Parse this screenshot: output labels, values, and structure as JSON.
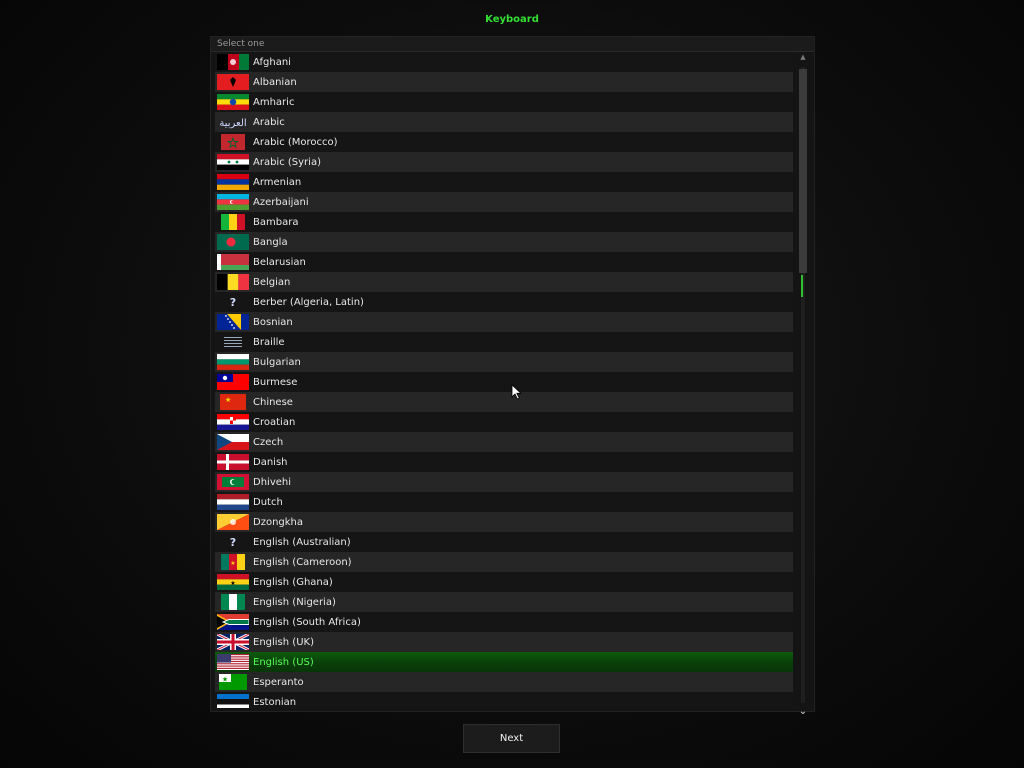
{
  "title": "Keyboard",
  "list_header": "Select one",
  "items": [
    {
      "label": "Afghani",
      "flag": "afghanistan"
    },
    {
      "label": "Albanian",
      "flag": "albania"
    },
    {
      "label": "Amharic",
      "flag": "ethiopia"
    },
    {
      "label": "Arabic",
      "flag": "arabic-script"
    },
    {
      "label": "Arabic (Morocco)",
      "flag": "morocco"
    },
    {
      "label": "Arabic (Syria)",
      "flag": "syria"
    },
    {
      "label": "Armenian",
      "flag": "armenia"
    },
    {
      "label": "Azerbaijani",
      "flag": "azerbaijan"
    },
    {
      "label": "Bambara",
      "flag": "mali"
    },
    {
      "label": "Bangla",
      "flag": "bangladesh"
    },
    {
      "label": "Belarusian",
      "flag": "belarus"
    },
    {
      "label": "Belgian",
      "flag": "belgium"
    },
    {
      "label": "Berber (Algeria, Latin)",
      "flag": "unknown"
    },
    {
      "label": "Bosnian",
      "flag": "bosnia"
    },
    {
      "label": "Braille",
      "flag": "braille"
    },
    {
      "label": "Bulgarian",
      "flag": "bulgaria"
    },
    {
      "label": "Burmese",
      "flag": "taiwan"
    },
    {
      "label": "Chinese",
      "flag": "china"
    },
    {
      "label": "Croatian",
      "flag": "croatia"
    },
    {
      "label": "Czech",
      "flag": "czech"
    },
    {
      "label": "Danish",
      "flag": "denmark"
    },
    {
      "label": "Dhivehi",
      "flag": "maldives"
    },
    {
      "label": "Dutch",
      "flag": "netherlands"
    },
    {
      "label": "Dzongkha",
      "flag": "bhutan"
    },
    {
      "label": "English (Australian)",
      "flag": "unknown"
    },
    {
      "label": "English (Cameroon)",
      "flag": "cameroon"
    },
    {
      "label": "English (Ghana)",
      "flag": "ghana"
    },
    {
      "label": "English (Nigeria)",
      "flag": "nigeria"
    },
    {
      "label": "English (South Africa)",
      "flag": "south-africa"
    },
    {
      "label": "English (UK)",
      "flag": "uk"
    },
    {
      "label": "English (US)",
      "flag": "usa",
      "selected": true
    },
    {
      "label": "Esperanto",
      "flag": "esperanto"
    },
    {
      "label": "Estonian",
      "flag": "estonia"
    }
  ],
  "next_label": "Next",
  "colors": {
    "accent": "#33e033",
    "selected_text": "#55ff55",
    "selected_bg": "#0a3f0a"
  }
}
